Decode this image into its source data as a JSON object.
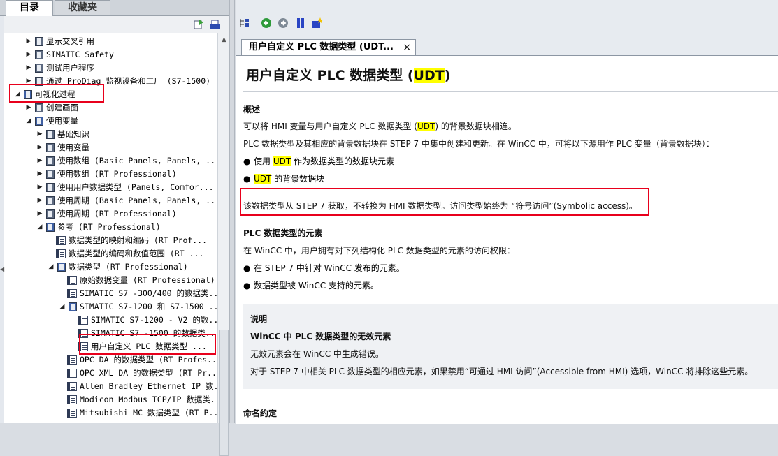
{
  "left_tabs": [
    {
      "label": "目录",
      "active": true
    },
    {
      "label": "收藏夹",
      "active": false
    }
  ],
  "tree": [
    {
      "label": "显示交叉引用",
      "level": 1,
      "state": "collapsed",
      "icon": "book-icon"
    },
    {
      "label": "SIMATIC Safety",
      "level": 1,
      "state": "collapsed",
      "icon": "book-icon"
    },
    {
      "label": "测试用户程序",
      "level": 1,
      "state": "collapsed",
      "icon": "book-icon"
    },
    {
      "label": "通过 ProDiag 监视设备和工厂 (S7-1500)",
      "level": 1,
      "state": "collapsed",
      "icon": "book-icon"
    },
    {
      "label": "可视化过程",
      "level": 0,
      "state": "expanded",
      "icon": "book-open-icon"
    },
    {
      "label": "创建画面",
      "level": 1,
      "state": "collapsed",
      "icon": "book-icon"
    },
    {
      "label": "使用变量",
      "level": 1,
      "state": "expanded",
      "icon": "book-open-icon"
    },
    {
      "label": "基础知识",
      "level": 2,
      "state": "collapsed",
      "icon": "book-icon"
    },
    {
      "label": "使用变量",
      "level": 2,
      "state": "collapsed",
      "icon": "book-icon"
    },
    {
      "label": "使用数组 (Basic Panels, Panels, ...",
      "level": 2,
      "state": "collapsed",
      "icon": "book-icon"
    },
    {
      "label": "使用数组 (RT Professional)",
      "level": 2,
      "state": "collapsed",
      "icon": "book-icon"
    },
    {
      "label": "使用用户数据类型 (Panels, Comfor...",
      "level": 2,
      "state": "collapsed",
      "icon": "book-icon"
    },
    {
      "label": "使用周期 (Basic Panels, Panels, ...",
      "level": 2,
      "state": "collapsed",
      "icon": "book-icon"
    },
    {
      "label": "使用周期 (RT Professional)",
      "level": 2,
      "state": "collapsed",
      "icon": "book-icon"
    },
    {
      "label": "参考 (RT Professional)",
      "level": 2,
      "state": "expanded",
      "icon": "book-open-icon"
    },
    {
      "label": "数据类型的映射和编码 (RT Prof...",
      "level": 3,
      "state": "leaf",
      "icon": "page-icon"
    },
    {
      "label": "数据类型的编码和数值范围 (RT ...",
      "level": 3,
      "state": "leaf",
      "icon": "page-icon"
    },
    {
      "label": "数据类型 (RT Professional)",
      "level": 3,
      "state": "expanded",
      "icon": "book-open-icon"
    },
    {
      "label": "原始数据变量 (RT Professional)",
      "level": 4,
      "state": "leaf",
      "icon": "page-icon"
    },
    {
      "label": "SIMATIC S7 -300/400 的数据类...",
      "level": 4,
      "state": "leaf",
      "icon": "page-icon"
    },
    {
      "label": "SIMATIC S7-1200 和 S7-1500 ...",
      "level": 4,
      "state": "expanded",
      "icon": "book-open-icon"
    },
    {
      "label": "SIMATIC S7-1200 - V2 的数...",
      "level": 5,
      "state": "leaf",
      "icon": "page-icon"
    },
    {
      "label": "SIMATIC S7 -1500 的数据类...",
      "level": 5,
      "state": "leaf",
      "icon": "page-icon"
    },
    {
      "label": "用户自定义 PLC 数据类型 ...",
      "level": 5,
      "state": "leaf",
      "icon": "page-icon",
      "selected": true
    },
    {
      "label": "OPC DA 的数据类型 (RT Profes...",
      "level": 4,
      "state": "leaf",
      "icon": "page-icon"
    },
    {
      "label": "OPC XML DA 的数据类型 (RT Pr...",
      "level": 4,
      "state": "leaf",
      "icon": "page-icon"
    },
    {
      "label": "Allen Bradley Ethernet IP 数...",
      "level": 4,
      "state": "leaf",
      "icon": "page-icon"
    },
    {
      "label": "Modicon Modbus TCP/IP 数据类...",
      "level": 4,
      "state": "leaf",
      "icon": "page-icon"
    },
    {
      "label": "Mitsubishi MC 数据类型 (RT P...",
      "level": 4,
      "state": "leaf",
      "icon": "page-icon"
    }
  ],
  "doc_tab": {
    "label": "用户自定义 PLC 数据类型 (UDT...",
    "close": "×"
  },
  "doc": {
    "title_prefix": "用户自定义 PLC 数据类型 (",
    "title_hl": "UDT",
    "title_suffix": ")",
    "overview_heading": "概述",
    "overview_p1_a": "可以将 HMI 变量与用户自定义 PLC 数据类型 (",
    "overview_p1_hl": "UDT",
    "overview_p1_b": ") 的背景数据块相连。",
    "overview_p2": "PLC 数据类型及其相应的背景数据块在 STEP 7 中集中创建和更新。在 WinCC 中，可将以下源用作 PLC 变量（背景数据块）：",
    "bullet1_a": "使用 ",
    "bullet1_hl": "UDT",
    "bullet1_b": " 作为数据类型的数据块元素",
    "bullet2_hl": "UDT",
    "bullet2_b": " 的背景数据块",
    "highlight_text": "该数据类型从 STEP 7 获取，不转换为 HMI 数据类型。访问类型始终为 “符号访问”(Symbolic access)。",
    "elements_heading": "PLC 数据类型的元素",
    "elements_p": "在 WinCC 中，用户拥有对下列结构化 PLC 数据类型的元素的访问权限：",
    "bullet3": "在 STEP 7 中针对 WinCC 发布的元素。",
    "bullet4": "数据类型被 WinCC 支持的元素。",
    "note_label": "说明",
    "note_heading": "WinCC 中 PLC 数据类型的无效元素",
    "note_p1": "无效元素会在 WinCC 中生成错误。",
    "note_p2": "对于 STEP 7 中相关 PLC 数据类型的相应元素，如果禁用“可通过 HMI 访问”(Accessible from HMI) 选项，WinCC 将排除这些元素。",
    "naming_heading": "命名约定"
  },
  "colors": {
    "highlight": "#ffff00",
    "annotation_red": "#e8001c"
  }
}
